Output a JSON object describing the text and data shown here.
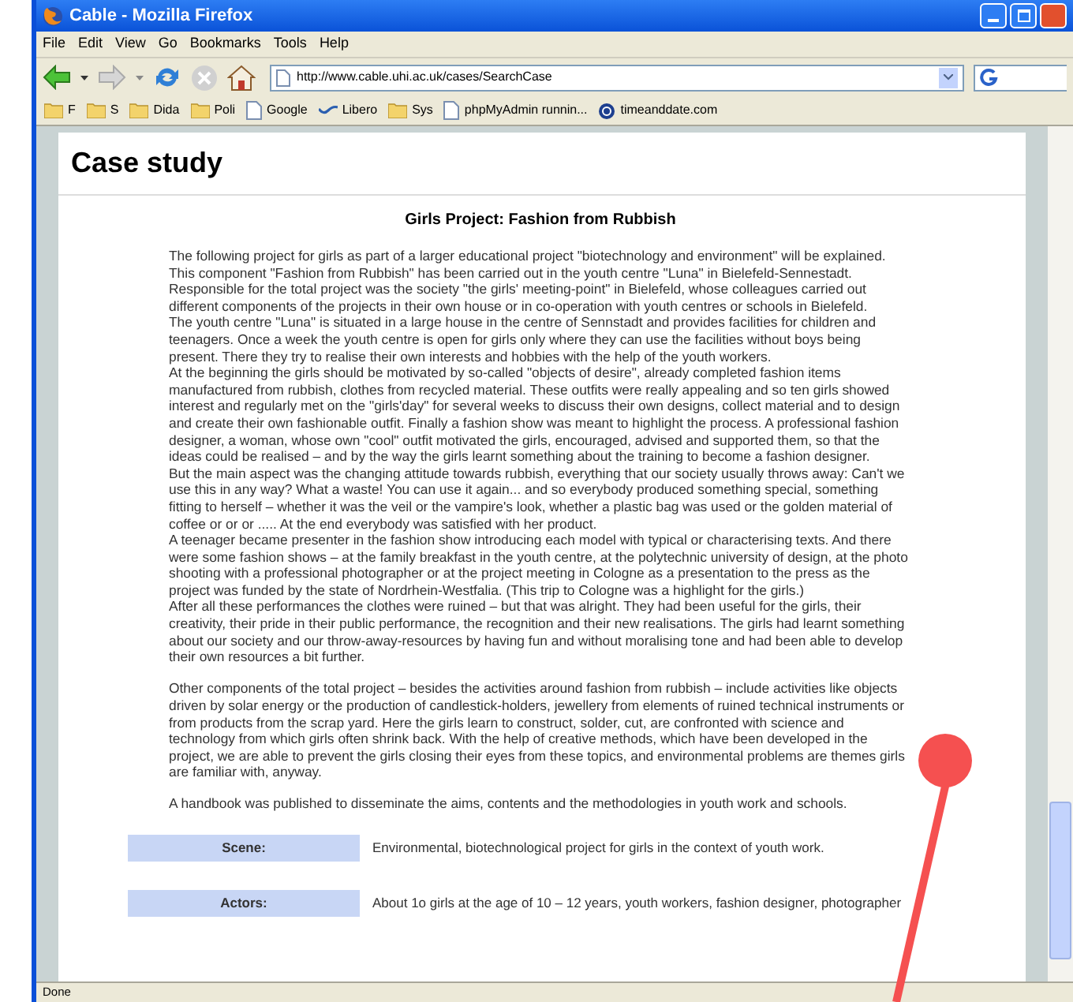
{
  "window": {
    "title": "Cable - Mozilla Firefox"
  },
  "menu": [
    "File",
    "Edit",
    "View",
    "Go",
    "Bookmarks",
    "Tools",
    "Help"
  ],
  "toolbar": {
    "url": "http://www.cable.uhi.ac.uk/cases/SearchCase"
  },
  "bookmarks": [
    {
      "kind": "folder",
      "label": "F"
    },
    {
      "kind": "folder",
      "label": "S"
    },
    {
      "kind": "folder",
      "label": "Dida"
    },
    {
      "kind": "folder",
      "label": "Poli"
    },
    {
      "kind": "page",
      "label": "Google"
    },
    {
      "kind": "wave",
      "label": "Libero"
    },
    {
      "kind": "folder",
      "label": "Sys"
    },
    {
      "kind": "page",
      "label": "phpMyAdmin runnin..."
    },
    {
      "kind": "globe",
      "label": "timeanddate.com"
    }
  ],
  "page": {
    "heading": "Case study",
    "article_title": "Girls Project: Fashion from Rubbish",
    "blocks": [
      [
        "The following project for girls as part of a larger educational project \"biotechnology and environment\" will be explained. This component \"Fashion from Rubbish\" has been carried out in the youth centre \"Luna\" in Bielefeld-Sennestadt. Responsible for the total project was the society \"the girls' meeting-point\" in Bielefeld, whose colleagues carried out different components of the projects in their own house or in co-operation with youth centres or schools in Bielefeld.",
        "The youth centre \"Luna\" is situated in a large house in the centre of Sennstadt and provides facilities for children and teenagers. Once a week the youth centre is open for girls only where they can use the facilities without boys being present. There they try to realise their own interests and hobbies with the help of the youth workers.",
        "At the beginning the girls should be motivated by so-called \"objects of desire\", already completed fashion items manufactured from rubbish, clothes from recycled material. These outfits were really appealing and so ten girls showed interest and regularly met on the \"girls'day\" for several weeks to discuss their own designs, collect material and to design and create their own fashionable outfit. Finally a fashion show was meant to highlight the process. A professional fashion designer, a woman, whose own \"cool\" outfit motivated the girls, encouraged, advised and supported them, so that the ideas could be realised – and by the way the girls learnt something about the training to become a fashion designer.",
        "But the main aspect was the changing attitude towards rubbish, everything that our society usually throws away: Can't we use this in any way? What a waste! You can use it again... and so everybody produced something special, something fitting to herself – whether it was the veil or the vampire's look, whether a plastic bag was used or the golden material of coffee or or or ..... At the end everybody was satisfied with her product.",
        "A teenager became presenter in the fashion show introducing each model with typical or characterising texts. And there were some fashion shows – at the family breakfast in the youth centre, at the polytechnic university of design, at the photo shooting with a professional photographer or at the project meeting in Cologne as a presentation to the press as the project was funded by the state of Nordrhein-Westfalia. (This trip to Cologne was a highlight for the girls.)",
        "After all these performances the clothes were ruined – but that was alright. They had been useful for the girls, their creativity, their pride in their public performance, the recognition and their new realisations. The girls had learnt something about our society and our throw-away-resources by having fun and without moralising tone and had been able to develop their own resources a bit further."
      ],
      [
        "Other components of the total project – besides the activities around fashion from rubbish – include activities like objects driven by solar energy or the production of candlestick-holders, jewellery from elements of ruined technical instruments or from products from the scrap yard. Here the girls learn to construct, solder, cut, are confronted with science and technology from which girls often shrink back. With the help of creative methods, which have been developed in the project, we are able to prevent the girls closing their eyes from these topics, and environmental problems are themes girls are familiar with, anyway."
      ],
      [
        "A handbook was published to disseminate the aims, contents and the methodologies in youth work and schools."
      ]
    ],
    "details": [
      {
        "label": "Scene:",
        "value": "Environmental, biotechnological project for girls in the context of youth work."
      },
      {
        "label": "Actors:",
        "value": "About 1o girls at the age of 10 – 12 years, youth workers, fashion designer, photographer"
      }
    ]
  },
  "status_bar": "Done"
}
